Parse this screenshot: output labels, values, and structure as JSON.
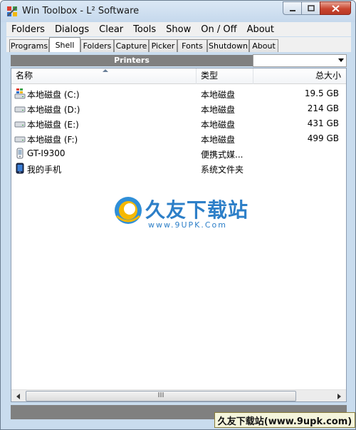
{
  "window": {
    "title": "Win Toolbox - L² Software"
  },
  "menu": [
    "Folders",
    "Dialogs",
    "Clear",
    "Tools",
    "Show",
    "On / Off",
    "About"
  ],
  "tabs": [
    {
      "label": "Programs",
      "active": false
    },
    {
      "label": "Shell",
      "active": true
    },
    {
      "label": "Folders",
      "active": false
    },
    {
      "label": "Capture",
      "active": false
    },
    {
      "label": "Picker",
      "active": false
    },
    {
      "label": "Fonts",
      "active": false
    },
    {
      "label": "Shutdown",
      "active": false
    },
    {
      "label": "About",
      "active": false
    }
  ],
  "printers": {
    "label": "Printers",
    "selected": ""
  },
  "list": {
    "columns": [
      "名称",
      "类型",
      "总大小"
    ],
    "rows": [
      {
        "icon": "windows-drive-icon",
        "name": "本地磁盘 (C:)",
        "type": "本地磁盘",
        "size": "19.5 GB"
      },
      {
        "icon": "drive-icon",
        "name": "本地磁盘 (D:)",
        "type": "本地磁盘",
        "size": "214 GB"
      },
      {
        "icon": "drive-icon",
        "name": "本地磁盘 (E:)",
        "type": "本地磁盘",
        "size": "431 GB"
      },
      {
        "icon": "drive-icon",
        "name": "本地磁盘 (F:)",
        "type": "本地磁盘",
        "size": "499 GB"
      },
      {
        "icon": "phone-icon",
        "name": "GT-I9300",
        "type": "便携式媒...",
        "size": ""
      },
      {
        "icon": "phone-screen-icon",
        "name": "我的手机",
        "type": "系统文件夹",
        "size": ""
      }
    ]
  },
  "watermark": {
    "title": "久友下载站",
    "sub": "www.9UPK.Com"
  },
  "status": {
    "badge": "久友下载站(www.9upk.com)"
  }
}
